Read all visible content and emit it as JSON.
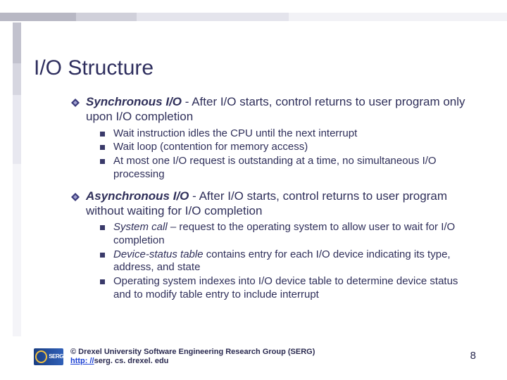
{
  "title": "I/O Structure",
  "items": [
    {
      "lead": "Synchronous I/O",
      "rest": " - After I/O starts, control returns to user program only upon I/O completion",
      "sub": [
        {
          "text": "Wait instruction idles the CPU until the next interrupt"
        },
        {
          "text": "Wait loop (contention for memory access)"
        },
        {
          "text": "At most one I/O request is outstanding at a time, no simultaneous I/O processing"
        }
      ]
    },
    {
      "lead": "Asynchronous I/O",
      "rest": " - After I/O starts, control returns to user program without waiting for I/O completion",
      "sub": [
        {
          "italic_lead": "System call",
          "text": " – request to the operating system to allow user to wait for I/O completion"
        },
        {
          "italic_lead": "Device-status table",
          "text": " contains entry for each I/O device indicating its type, address, and state"
        },
        {
          "text": "Operating system indexes into I/O device table to determine device status and to modify table entry to include interrupt"
        }
      ]
    }
  ],
  "footer": {
    "copyright": "© Drexel University Software Engineering Research Group (SERG)",
    "url_prefix": "http: //",
    "url_rest": "serg. cs. drexel. edu",
    "logo_text": "SERG"
  },
  "page_number": "8"
}
